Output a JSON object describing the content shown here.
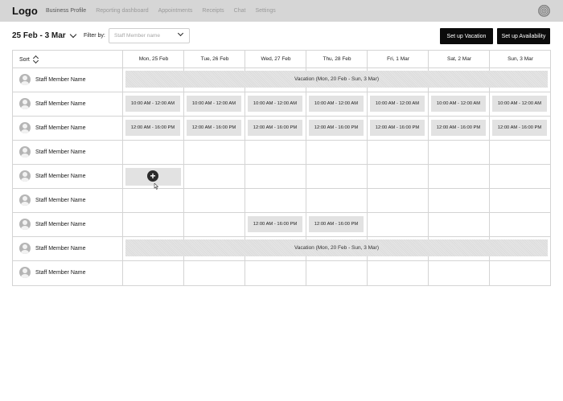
{
  "nav": {
    "logo": "Logo",
    "items": [
      "Business Profile",
      "Reporting dashboard",
      "Appointments",
      "Receipts",
      "Chat",
      "Settings"
    ],
    "active_index": 0
  },
  "toolbar": {
    "date_range": "25 Feb - 3 Mar",
    "filter_label": "Filter by:",
    "filter_placeholder": "Staff Member name",
    "vacation_button": "Set up Vacation",
    "availability_button": "Set up Availability"
  },
  "table": {
    "sort_label": "Sort",
    "days": [
      "Mon, 25 Feb",
      "Tue, 26 Feb",
      "Wed, 27 Feb",
      "Thu, 28 Feb",
      "Fri, 1 Mar",
      "Sat, 2 Mar",
      "Sun, 3 Mar"
    ],
    "staff": [
      "Staff Member Name",
      "Staff Member Name",
      "Staff Member Name",
      "Staff Member Name",
      "Staff Member Name",
      "Staff Member Name",
      "Staff Member Name",
      "Staff Member Name",
      "Staff Member Name"
    ],
    "vacation_text": "Vacation (Mon, 20 Feb - Sun, 3 Mar)",
    "slot_morning": "10:00 AM - 12:00 AM",
    "slot_afternoon": "12:00 AM - 16:00 PM"
  },
  "colors": {
    "button_bg": "#0b0b0b",
    "slot_bg": "#e2e2e2",
    "topbar_bg": "#d6d6d6"
  }
}
